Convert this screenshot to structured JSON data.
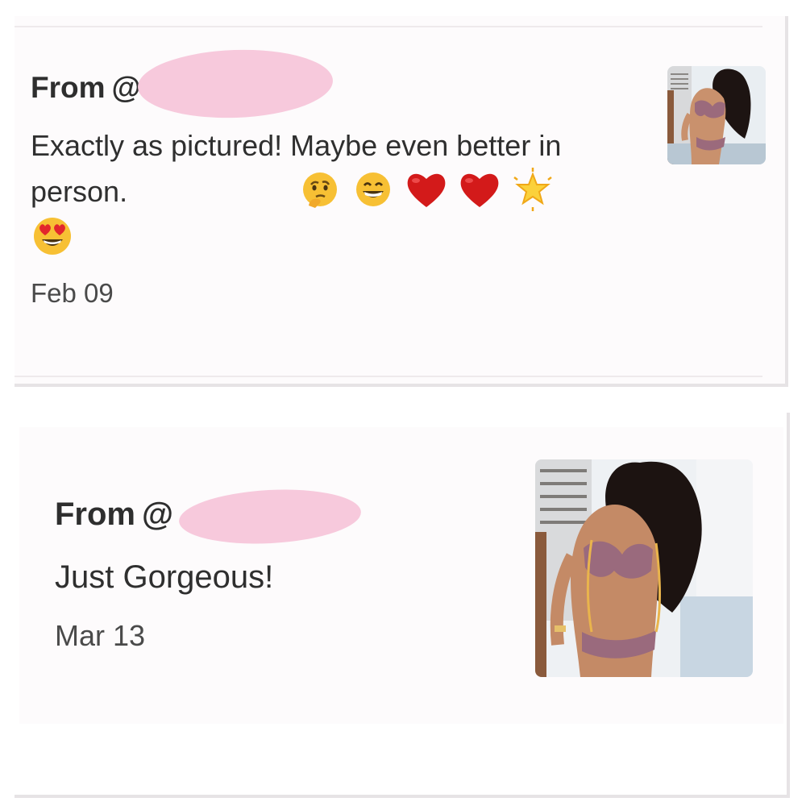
{
  "reviews": [
    {
      "from_label": "From",
      "handle_prefix": "@",
      "text": "Exactly as pictured! Maybe even better in person.",
      "emojis": [
        "thinking-face",
        "grinning-face",
        "red-heart",
        "red-heart",
        "glowing-star",
        "heart-eyes-face"
      ],
      "date": "Feb 09",
      "photo": "product-photo-thumbnail"
    },
    {
      "from_label": "From",
      "handle_prefix": "@",
      "text": "Just Gorgeous!",
      "date": "Mar 13",
      "photo": "product-photo-thumbnail"
    }
  ],
  "colors": {
    "redaction": "#f7c9dc",
    "card_background": "#fdfbfc",
    "text": "#2f2f2f"
  }
}
